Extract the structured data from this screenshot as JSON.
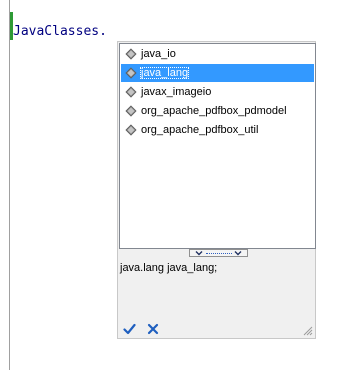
{
  "editor": {
    "code_text": "JavaClasses."
  },
  "completion": {
    "items": [
      {
        "label": "java_io",
        "icon": "package-icon"
      },
      {
        "label": "java_lang",
        "icon": "package-icon"
      },
      {
        "label": "javax_imageio",
        "icon": "package-icon"
      },
      {
        "label": "org_apache_pdfbox_pdmodel",
        "icon": "package-icon"
      },
      {
        "label": "org_apache_pdfbox_util",
        "icon": "package-icon"
      }
    ],
    "selected_label": "java_lang",
    "description": "java.lang java_lang;",
    "ok_icon": "check-icon",
    "cancel_icon": "close-icon"
  },
  "colors": {
    "selection": "#3399ff",
    "code": "#000080",
    "change_marker": "#2e9a35",
    "ok": "#1f5fbf",
    "cancel": "#1f5fbf"
  }
}
